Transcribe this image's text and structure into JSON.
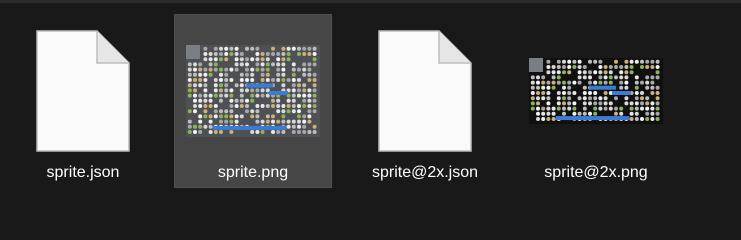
{
  "explorer": {
    "files": [
      {
        "name": "sprite.json",
        "icon": "generic-file-icon",
        "selected": false
      },
      {
        "name": "sprite.png",
        "icon": "image-thumbnail",
        "selected": true
      },
      {
        "name": "sprite@2x.json",
        "icon": "generic-file-icon",
        "selected": false
      },
      {
        "name": "sprite@2x.png",
        "icon": "image-thumbnail",
        "selected": false
      }
    ],
    "colors": {
      "background": "#191919",
      "selection": "#464646",
      "text": "#ffffff",
      "thumb_accent": "#3a7bd5"
    }
  }
}
